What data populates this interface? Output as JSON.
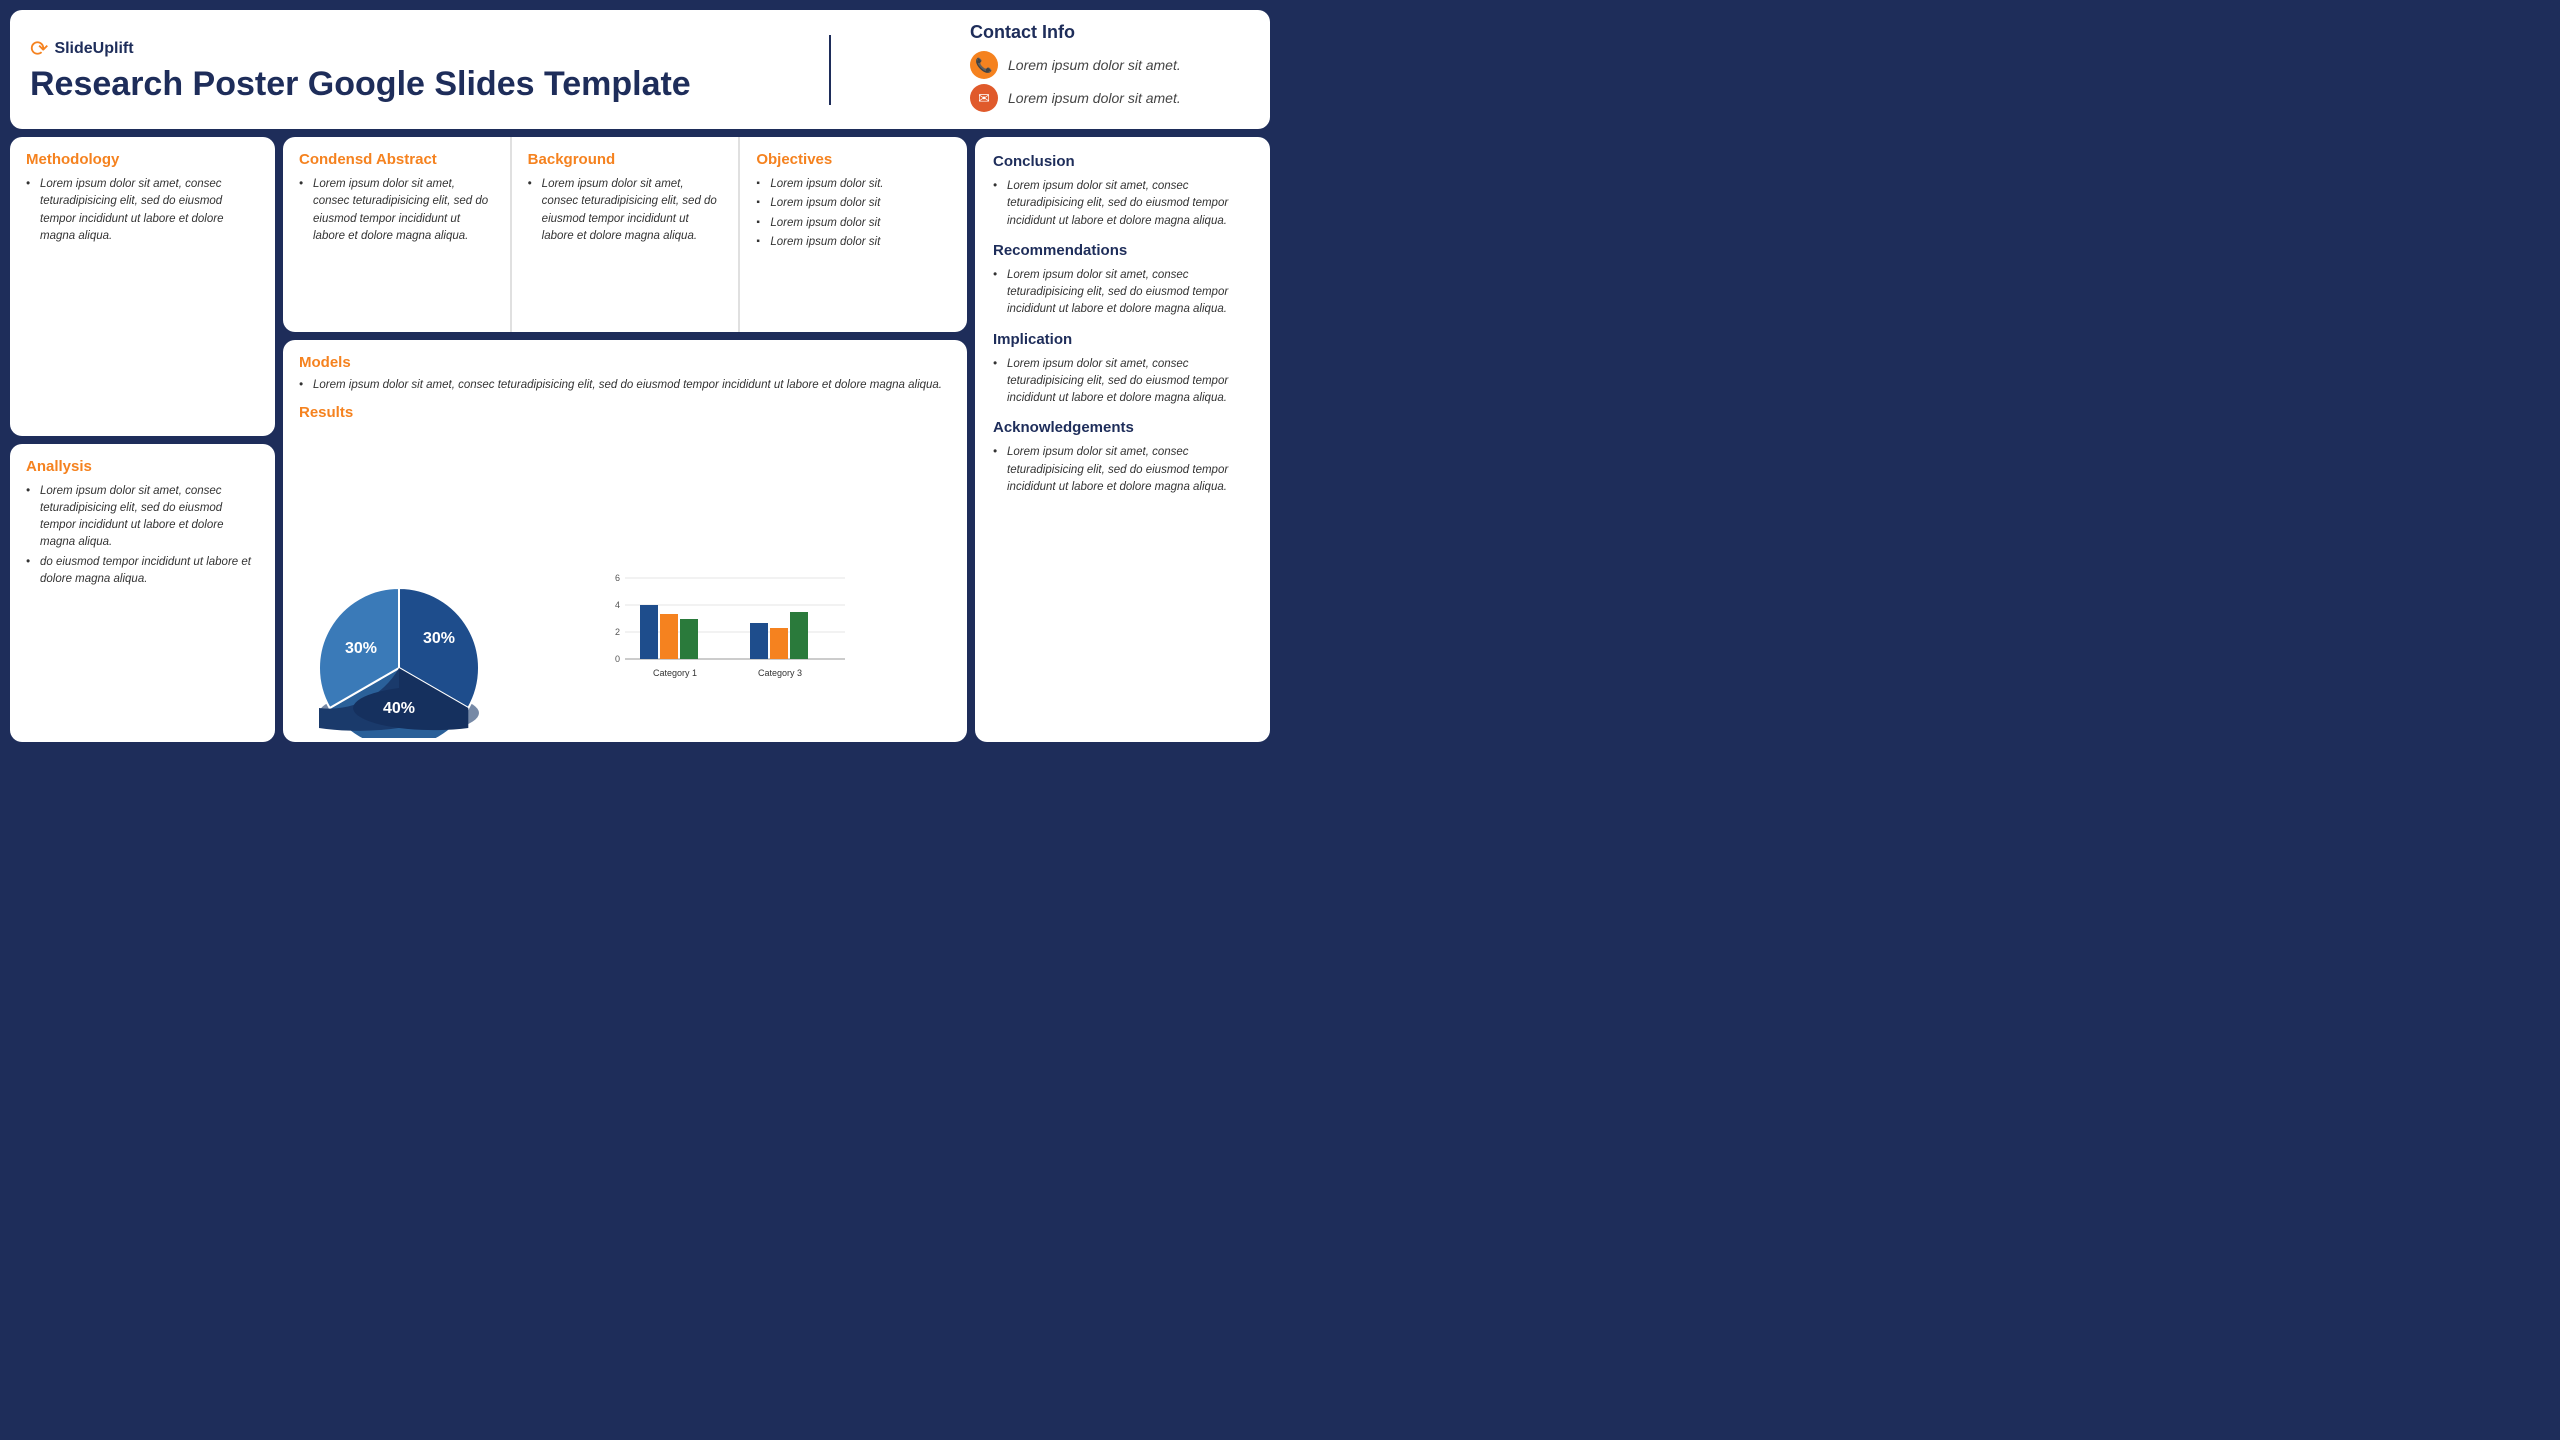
{
  "header": {
    "logo_text": "SlideUplift",
    "main_title": "Research Poster Google Slides Template",
    "contact": {
      "title": "Contact Info",
      "phone_text": "Lorem ipsum dolor sit amet.",
      "email_text": "Lorem ipsum dolor sit amet."
    }
  },
  "condensed_abstract": {
    "title": "Condensd Abstract",
    "text": "Lorem ipsum dolor sit amet, consec teturadipisicing elit, sed do eiusmod tempor incididunt ut labore et dolore magna aliqua."
  },
  "background": {
    "title": "Background",
    "text": "Lorem ipsum dolor sit amet, consec teturadipisicing elit, sed do eiusmod tempor incididunt ut labore et dolore magna aliqua."
  },
  "objectives": {
    "title": "Objectives",
    "items": [
      "Lorem ipsum dolor sit.",
      "Lorem ipsum dolor sit",
      "Lorem ipsum dolor sit",
      "Lorem ipsum dolor sit"
    ]
  },
  "methodology": {
    "title": "Methodology",
    "text": "Lorem ipsum dolor sit amet, consec teturadipisicing elit, sed do eiusmod tempor incididunt ut labore et dolore magna aliqua."
  },
  "analysis": {
    "title": "Anallysis",
    "items": [
      "Lorem ipsum dolor sit amet, consec teturadipisicing elit, sed do eiusmod tempor incididunt ut labore et dolore magna aliqua.",
      "do eiusmod tempor incididunt ut labore et dolore magna aliqua."
    ]
  },
  "models": {
    "title": "Models",
    "text": "Lorem ipsum dolor sit amet, consec teturadipisicing elit, sed do eiusmod tempor incididunt ut labore et dolore magna aliqua."
  },
  "results": {
    "title": "Results",
    "pie_data": [
      {
        "label": "30%",
        "value": 30
      },
      {
        "label": "30%",
        "value": 30
      },
      {
        "label": "40%",
        "value": 40
      }
    ],
    "bar_categories": [
      "Category 1",
      "Category 3"
    ],
    "bar_y_labels": [
      "0",
      "2",
      "4",
      "6"
    ],
    "bar_data": {
      "blue": [
        4,
        2
      ],
      "orange": [
        3,
        1.8
      ],
      "green": [
        2.5,
        3.5
      ]
    }
  },
  "conclusion": {
    "title": "Conclusion",
    "text": "Lorem ipsum dolor sit amet, consec teturadipisicing elit, sed do eiusmod tempor incididunt ut labore et dolore magna aliqua."
  },
  "recommendations": {
    "title": "Recommendations",
    "text": "Lorem ipsum dolor sit amet, consec teturadipisicing elit, sed do eiusmod tempor incididunt ut labore et dolore magna aliqua."
  },
  "implication": {
    "title": "Implication",
    "text": "Lorem ipsum dolor sit amet, consec teturadipisicing elit, sed do eiusmod tempor incididunt ut labore et dolore magna aliqua."
  },
  "acknowledgements": {
    "title": "Acknowledgements",
    "text": "Lorem ipsum dolor sit amet, consec teturadipisicing elit, sed do eiusmod tempor incididunt ut labore et dolore magna aliqua."
  }
}
